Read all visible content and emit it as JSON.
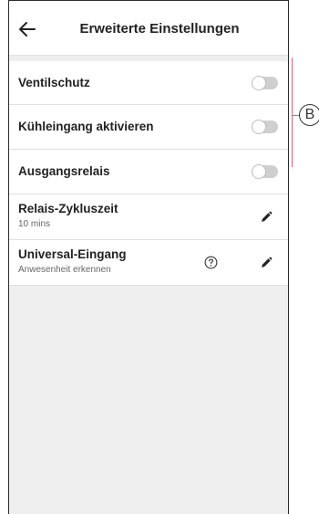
{
  "header": {
    "title": "Erweiterte Einstellungen",
    "back_icon": "arrow-left-icon"
  },
  "settings": [
    {
      "label": "Ventilschutz",
      "control": "toggle",
      "enabled": false
    },
    {
      "label": "Kühleingang aktivieren",
      "control": "toggle",
      "enabled": false
    },
    {
      "label": "Ausgangsrelais",
      "control": "toggle",
      "enabled": false
    },
    {
      "label": "Relais-Zykluszeit",
      "value": "10 mins",
      "control": "edit"
    },
    {
      "label": "Universal-Eingang",
      "value": "Anwesenheit erkennen",
      "control": "edit",
      "help_icon": "question-circle-icon"
    }
  ],
  "annotation": {
    "label": "B",
    "color": "#e0607e"
  },
  "colors": {
    "background": "#efefef",
    "toggle_off": "#cfcfcf"
  }
}
